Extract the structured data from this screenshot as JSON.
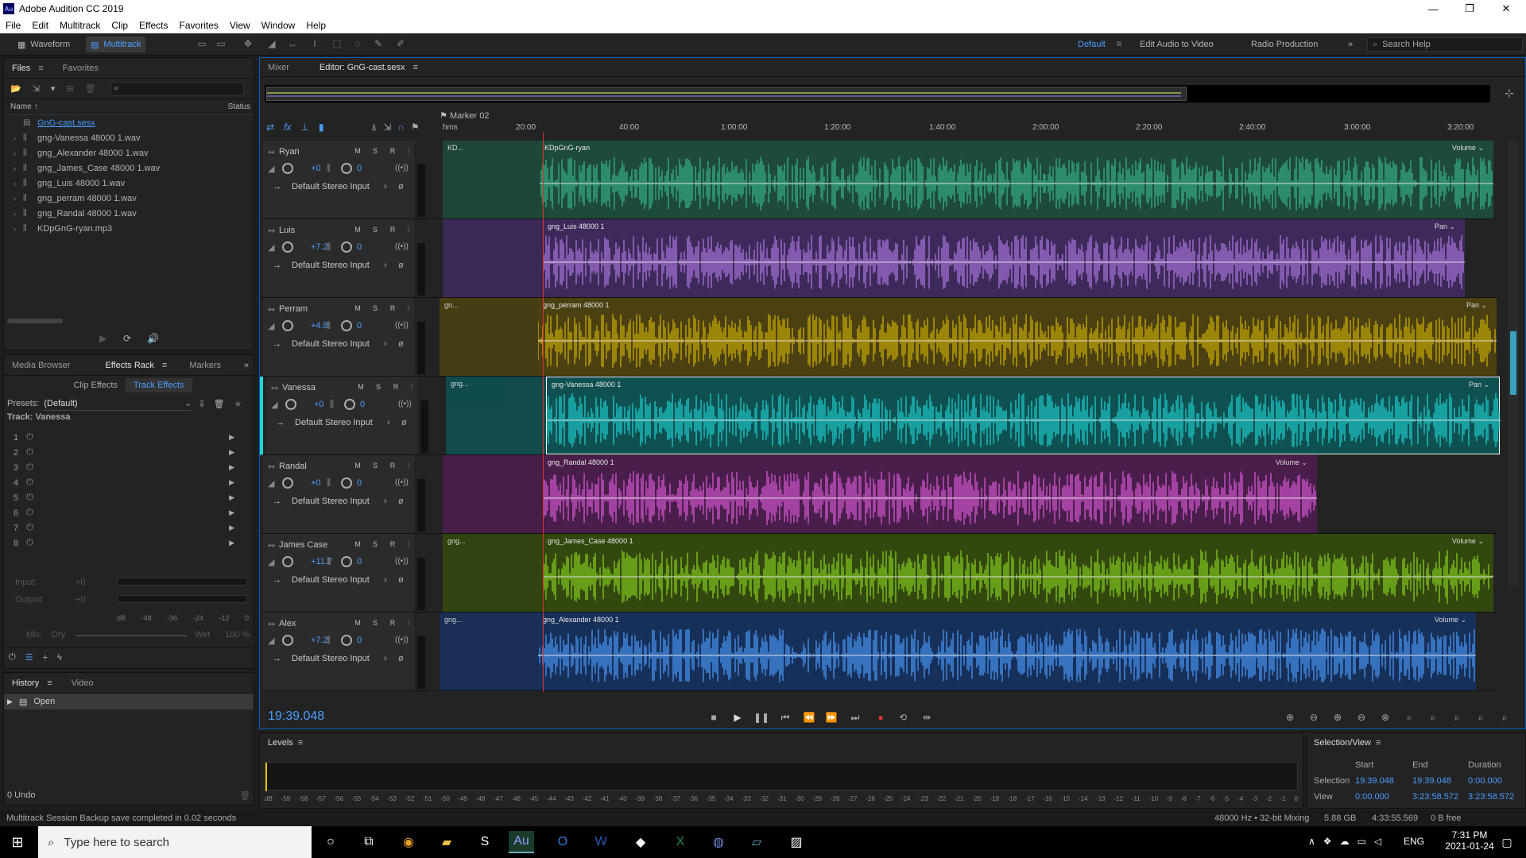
{
  "titlebar": {
    "app_icon": "Au",
    "title": "Adobe Audition CC 2019",
    "minimize": "—",
    "maximize": "❐",
    "close": "✕"
  },
  "menubar": {
    "items": [
      "File",
      "Edit",
      "Multitrack",
      "Clip",
      "Effects",
      "Favorites",
      "View",
      "Window",
      "Help"
    ]
  },
  "toolbar": {
    "waveform_label": "Waveform",
    "multitrack_label": "Multitrack",
    "workspaces": [
      "Default",
      "Edit Audio to Video",
      "Radio Production"
    ],
    "more": "»",
    "search_placeholder": "Search Help"
  },
  "files_panel": {
    "tabs": [
      "Files",
      "Favorites"
    ],
    "col_name": "Name",
    "col_status": "Status",
    "files": [
      "GnG-cast.sesx",
      "gng-Vanessa 48000 1.wav",
      "gng_Alexander 48000 1.wav",
      "gng_James_Case 48000 1.wav",
      "gng_Luis 48000 1.wav",
      "gng_perram 48000 1.wav",
      "gng_Randal 48000 1.wav",
      "KDpGnG-ryan.mp3"
    ]
  },
  "effects_panel": {
    "tabs": [
      "Media Browser",
      "Effects Rack",
      "Markers"
    ],
    "subtabs": [
      "Clip Effects",
      "Track Effects"
    ],
    "presets_label": "Presets:",
    "preset_value": "(Default)",
    "track_label": "Track: Vanessa",
    "slots": [
      "1",
      "2",
      "3",
      "4",
      "5",
      "6",
      "7",
      "8"
    ],
    "input_label": "Input:",
    "output_label": "Output:",
    "input_val": "+0",
    "output_val": "+0",
    "db_ticks": [
      "dB",
      "-48",
      "-36",
      "-24",
      "-12",
      "0"
    ],
    "mix_label": "Mix:",
    "dry": "Dry",
    "wet": "Wet",
    "wet_pct": "100 %"
  },
  "history_panel": {
    "tabs": [
      "History",
      "Video"
    ],
    "items": [
      "Open"
    ],
    "undo": "0 Undo"
  },
  "editor": {
    "tabs": [
      "Mixer",
      "Editor: GnG-cast.sesx"
    ],
    "marker": "Marker 02",
    "ruler_unit": "hms",
    "ruler": [
      "20:00",
      "40:00",
      "1:00:00",
      "1:20:00",
      "1:40:00",
      "2:00:00",
      "2:20:00",
      "2:40:00",
      "3:00:00",
      "3:20:00"
    ],
    "playhead_time": "19:39.048"
  },
  "tracks": [
    {
      "name": "Ryan",
      "vol": "+0",
      "pan": "0",
      "input": "Default Stereo Input",
      "clip": "KDpGnG-ryan",
      "stub": "KD...",
      "label": "Volume",
      "color": "#38b88a",
      "bg": "#1e4a3a"
    },
    {
      "name": "Luis",
      "vol": "+7.2",
      "pan": "0",
      "input": "Default Stereo Input",
      "clip": "gng_Luis 48000 1",
      "stub": "",
      "label": "Pan",
      "color": "#b37ae8",
      "bg": "#3d2a5a"
    },
    {
      "name": "Perram",
      "vol": "+4.8",
      "pan": "0",
      "input": "Default Stereo Input",
      "clip": "gng_perram 48000 1",
      "stub": "gn...",
      "label": "Pan",
      "color": "#d4b400",
      "bg": "#4a4012"
    },
    {
      "name": "Vanessa",
      "vol": "+0",
      "pan": "0",
      "input": "Default Stereo Input",
      "clip": "gng-Vanessa 48000 1",
      "stub": "gng...",
      "label": "Pan",
      "color": "#1fd6d6",
      "bg": "#0f5050"
    },
    {
      "name": "Randal",
      "vol": "+0",
      "pan": "0",
      "input": "Default Stereo Input",
      "clip": "gng_Randal 48000 1",
      "stub": "",
      "label": "Volume",
      "color": "#e05ae0",
      "bg": "#4a1e4a"
    },
    {
      "name": "James Case",
      "vol": "+11.7",
      "pan": "0",
      "input": "Default Stereo Input",
      "clip": "gng_James_Case 48000 1",
      "stub": "gng...",
      "label": "Volume",
      "color": "#8ad61e",
      "bg": "#33480f"
    },
    {
      "name": "Alex",
      "vol": "+7.2",
      "pan": "0",
      "input": "Default Stereo Input",
      "clip": "gng_Alexander 48000 1",
      "stub": "gng...",
      "label": "Volume",
      "color": "#4a9eff",
      "bg": "#17305a"
    }
  ],
  "levels": {
    "title": "Levels",
    "ticks": [
      "dB",
      "-59",
      "-58",
      "-57",
      "-56",
      "-55",
      "-54",
      "-53",
      "-52",
      "-51",
      "-50",
      "-49",
      "-48",
      "-47",
      "-46",
      "-45",
      "-44",
      "-43",
      "-42",
      "-41",
      "-40",
      "-39",
      "-38",
      "-37",
      "-36",
      "-35",
      "-34",
      "-33",
      "-32",
      "-31",
      "-30",
      "-29",
      "-28",
      "-27",
      "-26",
      "-25",
      "-24",
      "-23",
      "-22",
      "-21",
      "-20",
      "-19",
      "-18",
      "-17",
      "-16",
      "-15",
      "-14",
      "-13",
      "-12",
      "-11",
      "-10",
      "-9",
      "-8",
      "-7",
      "-6",
      "-5",
      "-4",
      "-3",
      "-2",
      "-1",
      "0"
    ]
  },
  "selection_view": {
    "title": "Selection/View",
    "col_start": "Start",
    "col_end": "End",
    "col_duration": "Duration",
    "selection_label": "Selection",
    "sel_start": "19:39.048",
    "sel_end": "19:39.048",
    "sel_dur": "0:00.000",
    "view_label": "View",
    "view_start": "0:00.000",
    "view_end": "3:23:58.572",
    "view_dur": "3:23:58.572"
  },
  "statusbar": {
    "message": "Multitrack Session Backup save completed in 0.02 seconds",
    "format": "48000 Hz • 32-bit Mixing",
    "size": "5.88 GB",
    "duration": "4:33:55.569",
    "free": "0 B free"
  },
  "taskbar": {
    "search_placeholder": "Type here to search",
    "lang": "ENG",
    "time": "7:31 PM",
    "date": "2021-01-24"
  }
}
